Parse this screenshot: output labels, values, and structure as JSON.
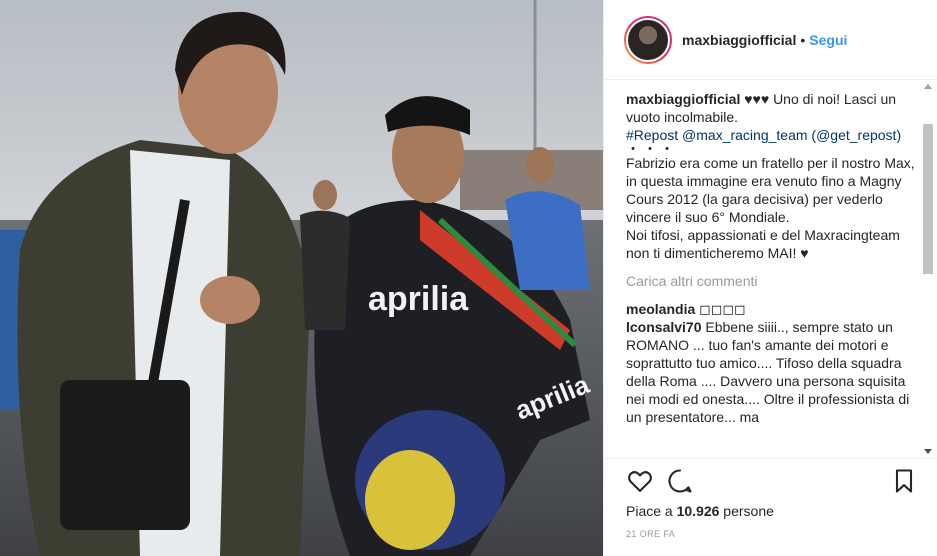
{
  "post": {
    "image_alt": "",
    "username": "maxbiaggiofficial",
    "separator": "•",
    "follow_label": "Segui"
  },
  "caption": {
    "username": "maxbiaggiofficial",
    "line1_rest": " ♥♥♥ Uno di noi! Lasci un vuoto incolmabile.",
    "repost": "#Repost @max_racing_team (@get_repost)",
    "dots": "・・・",
    "body1": "Fabrizio era come un fratello per il nostro Max, in questa immagine era venuto fino a Magny Cours 2012 (la gara decisiva) per vederlo vincere il suo 6° Mondiale.",
    "body2": "Noi tifosi, appassionati e del Maxracingteam non ti dimenticheremo MAI! ♥"
  },
  "load_more_label": "Carica altri commenti",
  "comments": [
    {
      "user": "meolandia",
      "text": " ◻◻◻◻"
    },
    {
      "user": "lconsalvi70",
      "text": " Ebbene siiii.., sempre stato un ROMANO ... tuo fan's amante dei motori e soprattutto tuo amico.... Tifoso della squadra della Roma .... Davvero una persona squisita nei modi ed onesta.... Oltre il professionista di un presentatore... ma"
    }
  ],
  "actions": {
    "like_icon": "heart-icon",
    "comment_icon": "comment-icon",
    "save_icon": "bookmark-icon"
  },
  "likes_prefix": "Piace a ",
  "likes_count": "10.926",
  "likes_suffix": " persone",
  "timestamp": "21 ORE FA"
}
